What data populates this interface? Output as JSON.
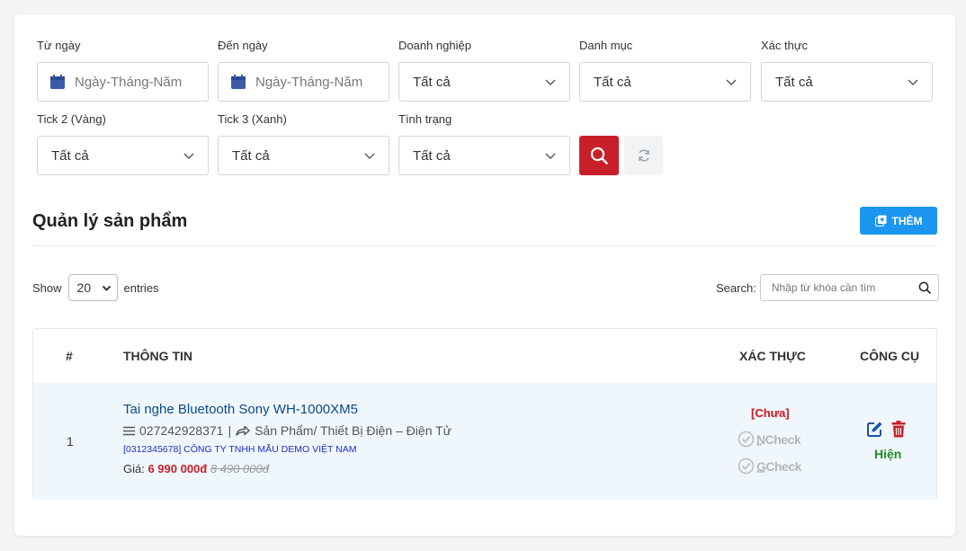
{
  "filters": {
    "from_date": {
      "label": "Từ ngày",
      "placeholder": "Ngày-Tháng-Năm"
    },
    "to_date": {
      "label": "Đến ngày",
      "placeholder": "Ngày-Tháng-Năm"
    },
    "enterprise": {
      "label": "Doanh nghiệp",
      "value": "Tất cả"
    },
    "category": {
      "label": "Danh mục",
      "value": "Tất cả"
    },
    "verification": {
      "label": "Xác thực",
      "value": "Tất cả"
    },
    "tick2": {
      "label": "Tick 2 (Vàng)",
      "value": "Tất cả"
    },
    "tick3": {
      "label": "Tick 3 (Xanh)",
      "value": "Tất cả"
    },
    "status": {
      "label": "Tình trạng",
      "value": "Tất cả"
    }
  },
  "page": {
    "title": "Quản lý sản phẩm",
    "add_label": "THÊM"
  },
  "table_controls": {
    "show_label": "Show",
    "page_length": "20",
    "entries_label": "entries",
    "search_label": "Search:",
    "search_placeholder": "Nhập từ khóa cần tìm"
  },
  "table": {
    "headers": {
      "index": "#",
      "info": "THÔNG TIN",
      "verify": "XÁC THỰC",
      "tools": "CÔNG CỤ"
    },
    "rows": [
      {
        "index": "1",
        "name": "Tai nghe Bluetooth Sony WH-1000XM5",
        "code": "027242928371",
        "separator": "|",
        "category": "Sản Phẩm/ Thiết Bị Điện – Điện Tử",
        "company": "[0312345678] CÔNG TY TNHH MẪU DEMO VIỆT NAM",
        "price_label": "Giá:",
        "price": "6 990 000đ",
        "old_price": "8 490 000đ",
        "verify_status": "[Chưa]",
        "badge1": "NCheck",
        "badge1_stars": "**",
        "badge2": "GCheck",
        "badge2_stars": "***",
        "visibility": "Hiện"
      }
    ]
  },
  "colors": {
    "primary_red": "#c8202a",
    "add_blue": "#1a96f0",
    "link_blue": "#0b4a8c",
    "success_green": "#1e8e1e"
  }
}
